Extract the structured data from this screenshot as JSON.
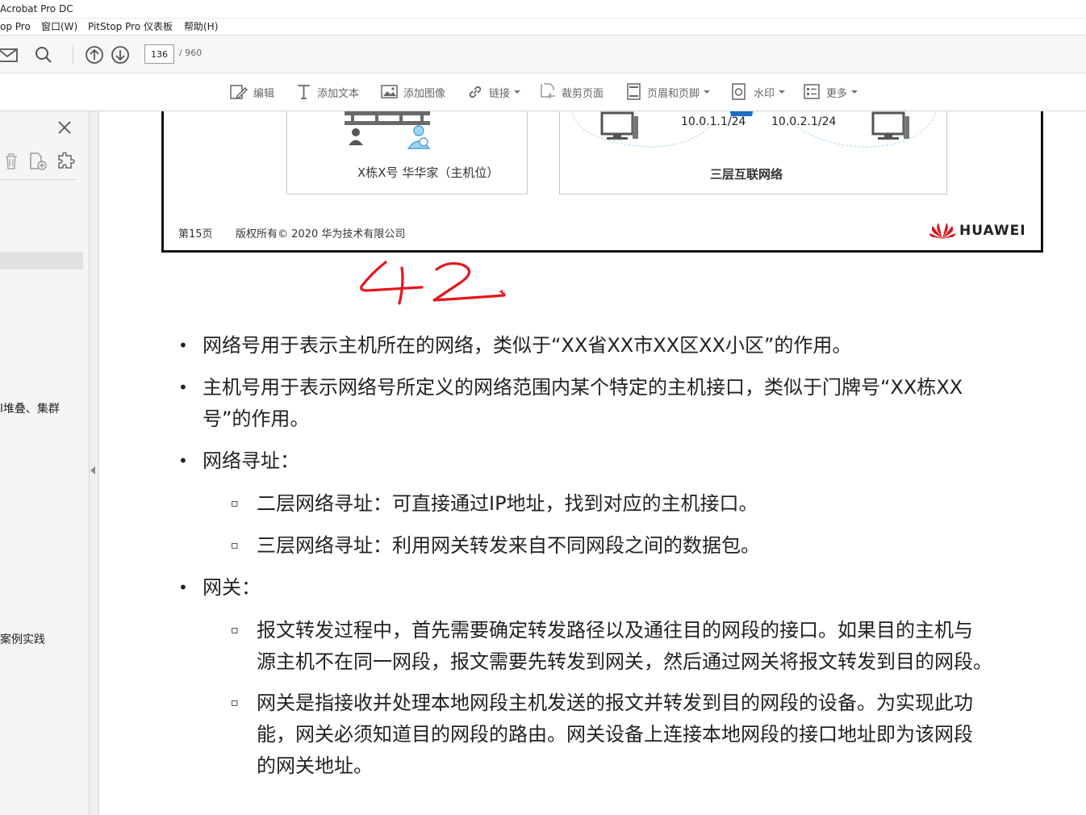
{
  "window": {
    "title": "Acrobat Pro DC"
  },
  "menu": {
    "items": [
      "op Pro",
      "窗口(W)",
      "PitStop Pro 仪表板",
      "帮助(H)"
    ]
  },
  "toolbar": {
    "page_current": "136",
    "page_total": "/ 960"
  },
  "edit_toolbar": {
    "edit": "编辑",
    "add_text": "添加文本",
    "add_image": "添加图像",
    "link": "链接",
    "crop": "裁剪页面",
    "header_footer": "页眉和页脚",
    "watermark": "水印",
    "more": "更多"
  },
  "sidebar": {
    "item1": "l堆叠、集群",
    "item2": "案例实践"
  },
  "slide": {
    "host_caption": "X栋X号 华华家（主机位）",
    "ip_left": "10.0.1.1/24",
    "ip_right": "10.0.2.1/24",
    "network_caption": "三层互联网络",
    "footer_page": "第15页",
    "footer_copyright": "版权所有© 2020 华为技术有限公司",
    "brand": "HUAWEI"
  },
  "annotation": {
    "handwritten": "42",
    "color": "#e8141b"
  },
  "content": {
    "b1": "网络号用于表示主机所在的网络，类似于“XX省XX市XX区XX小区”的作用。",
    "b2_l1": "主机号用于表示网络号所定义的网络范围内某个特定的主机接口，类似于门牌号“XX栋XX",
    "b2_l2": "号”的作用。",
    "b3": "网络寻址：",
    "b3_s1": "二层网络寻址：可直接通过IP地址，找到对应的主机接口。",
    "b3_s2": "三层网络寻址：利用网关转发来自不同网段之间的数据包。",
    "b4": "网关：",
    "b4_s1_l1": "报文转发过程中，首先需要确定转发路径以及通往目的网段的接口。如果目的主机与",
    "b4_s1_l2": "源主机不在同一网段，报文需要先转发到网关，然后通过网关将报文转发到目的网段。",
    "b4_s2_l1": "网关是指接收并处理本地网段主机发送的报文并转发到目的网段的设备。为实现此功",
    "b4_s2_l2": "能，网关必须知道目的网段的路由。网关设备上连接本地网段的接口地址即为该网段",
    "b4_s2_l3": "的网关地址。",
    "bullet": "•",
    "sub_bullet": "▫"
  }
}
